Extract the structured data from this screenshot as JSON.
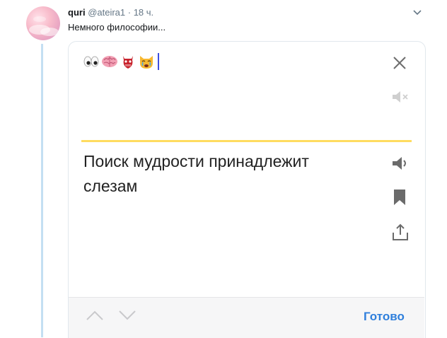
{
  "tweet": {
    "author_name": "quri",
    "author_handle": "@ateira1",
    "separator": " · ",
    "time": "18 ч.",
    "text": "Немного философии..."
  },
  "translator": {
    "input_emojis": [
      "eyes-emoji",
      "brain-emoji",
      "ogre-mask-emoji",
      "crying-cat-emoji"
    ],
    "translation": "Поиск мудрости принадлежит слезам",
    "done_label": "Готово",
    "accent_color": "#ffdc60",
    "action_color": "#2f7fdc",
    "icons": [
      "close-icon",
      "mute-icon",
      "speaker-icon",
      "bookmark-icon",
      "share-icon",
      "chevron-up-icon",
      "chevron-down-icon"
    ]
  }
}
